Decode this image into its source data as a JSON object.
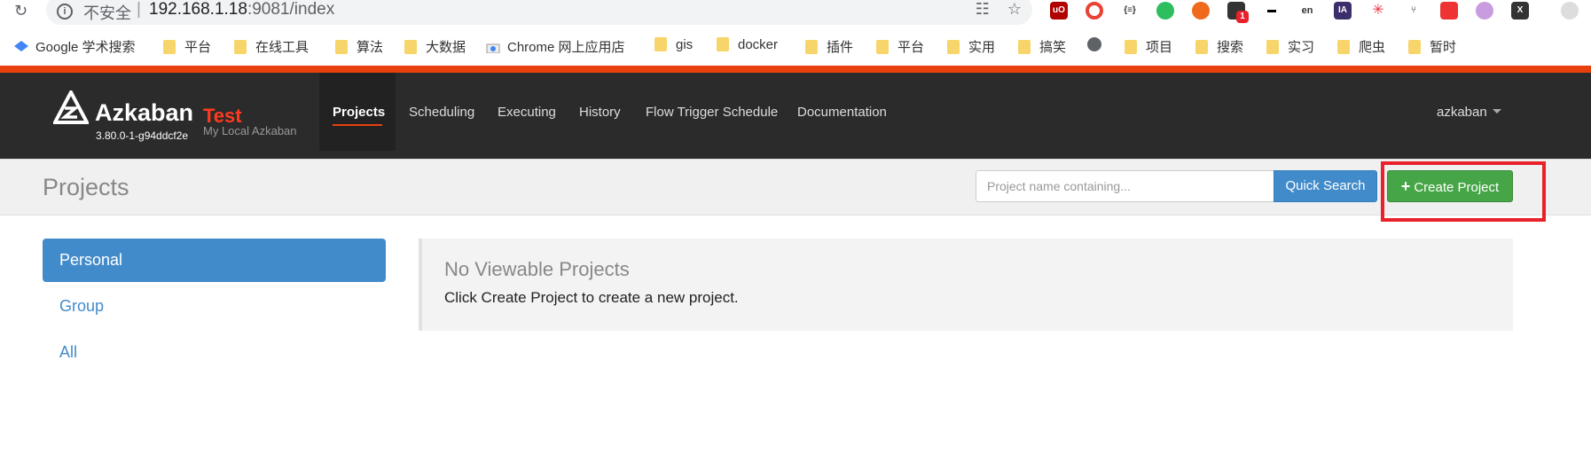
{
  "browser": {
    "security_label": "不安全",
    "separator": "|",
    "url_host": "192.168.1.18",
    "url_rest": ":9081/index",
    "reload_icon": "reload-icon",
    "ext_badge": "1",
    "ext_ia_label": "IA",
    "bookmarks": [
      {
        "label": "Google 学术搜索",
        "icon": "google-scholar-icon"
      },
      {
        "label": "平台",
        "icon": "folder-icon"
      },
      {
        "label": "在线工具",
        "icon": "folder-icon"
      },
      {
        "label": "算法",
        "icon": "folder-icon"
      },
      {
        "label": "大数据",
        "icon": "folder-icon"
      },
      {
        "label": "Chrome 网上应用店",
        "icon": "chrome-store-icon"
      },
      {
        "label": "gis",
        "icon": "folder-icon"
      },
      {
        "label": "docker",
        "icon": "folder-icon"
      },
      {
        "label": "插件",
        "icon": "folder-icon"
      },
      {
        "label": "平台",
        "icon": "folder-icon"
      },
      {
        "label": "实用",
        "icon": "folder-icon"
      },
      {
        "label": "搞笑",
        "icon": "folder-icon"
      },
      {
        "label": "",
        "icon": "globe-icon"
      },
      {
        "label": "项目",
        "icon": "folder-icon"
      },
      {
        "label": "搜索",
        "icon": "folder-icon"
      },
      {
        "label": "实习",
        "icon": "folder-icon"
      },
      {
        "label": "爬虫",
        "icon": "folder-icon"
      },
      {
        "label": "暂时",
        "icon": "folder-icon"
      }
    ]
  },
  "navbar": {
    "brand": "Azkaban",
    "env": "Test",
    "version": "3.80.0-1-g94ddcf2e",
    "subtitle": "My Local Azkaban",
    "items": [
      "Projects",
      "Scheduling",
      "Executing",
      "History",
      "Flow Trigger Schedule",
      "Documentation"
    ],
    "active_item": "Projects",
    "user": "azkaban"
  },
  "header": {
    "title": "Projects",
    "search_placeholder": "Project name containing...",
    "quick_search_label": "Quick Search",
    "create_label": "Create Project"
  },
  "sidebar": {
    "items": [
      "Personal",
      "Group",
      "All"
    ],
    "active": "Personal"
  },
  "panel": {
    "title": "No Viewable Projects",
    "message": "Click Create Project to create a new project."
  },
  "colors": {
    "accent_orange": "#e8400c",
    "navbar_bg": "#2b2b2b",
    "primary_blue": "#428bca",
    "success_green": "#46a546",
    "highlight_red": "#e8212a"
  }
}
